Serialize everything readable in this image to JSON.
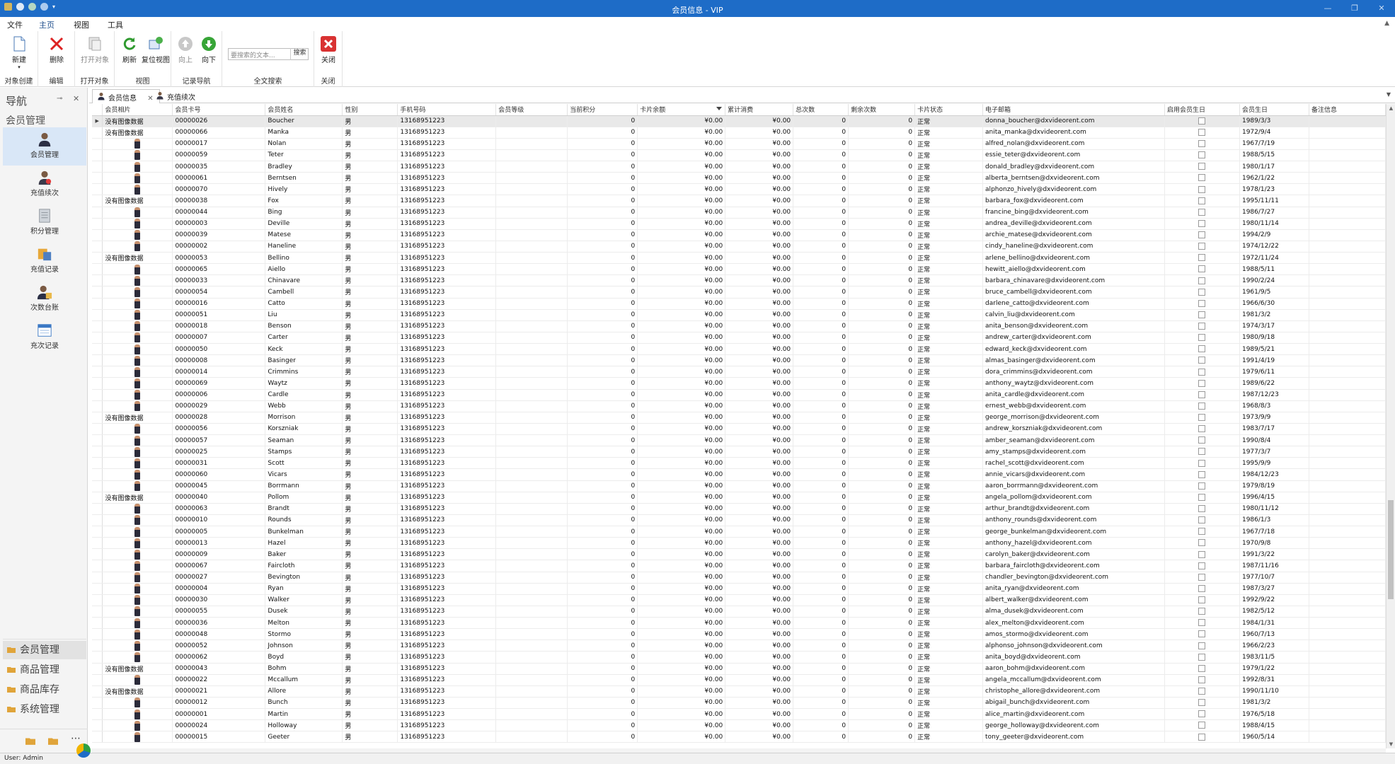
{
  "window": {
    "title": "会员信息 - VIP",
    "controls": [
      "—",
      "❐",
      "✕"
    ]
  },
  "menu": {
    "items": [
      "文件",
      "主页",
      "视图",
      "工具"
    ],
    "active_index": 1
  },
  "ribbon": {
    "groups": [
      {
        "label": "对象创建",
        "buttons": [
          {
            "label": "新建",
            "icon": "new-document-icon"
          }
        ]
      },
      {
        "label": "编辑",
        "buttons": [
          {
            "label": "删除",
            "icon": "delete-x-icon"
          }
        ]
      },
      {
        "label": "打开对象",
        "buttons": [
          {
            "label": "打开对象",
            "icon": "open-object-icon"
          }
        ]
      },
      {
        "label": "视图",
        "buttons": [
          {
            "label": "刷新",
            "icon": "refresh-icon"
          },
          {
            "label": "复位视图",
            "icon": "reset-view-icon"
          }
        ]
      },
      {
        "label": "记录导航",
        "buttons": [
          {
            "label": "向上",
            "icon": "arrow-up-icon"
          },
          {
            "label": "向下",
            "icon": "arrow-down-icon"
          }
        ]
      },
      {
        "label": "全文搜索",
        "search_placeholder": "要搜索的文本...",
        "search_button": "搜索"
      },
      {
        "label": "关闭",
        "buttons": [
          {
            "label": "关闭",
            "icon": "close-red-icon"
          }
        ]
      }
    ]
  },
  "nav": {
    "header": "导航",
    "pin": "⊸",
    "close": "✕",
    "group_title": "会员管理",
    "items": [
      {
        "label": "会员管理",
        "icon": "member-icon"
      },
      {
        "label": "充值续次",
        "icon": "recharge-icon"
      },
      {
        "label": "积分管理",
        "icon": "points-icon"
      },
      {
        "label": "充值记录",
        "icon": "recharge-record-icon"
      },
      {
        "label": "次数台账",
        "icon": "count-ledger-icon"
      },
      {
        "label": "充次记录",
        "icon": "count-record-icon"
      }
    ],
    "bottom_groups": [
      "会员管理",
      "商品管理",
      "商品库存",
      "系统管理"
    ],
    "footer_more": "⋯"
  },
  "doc_tabs": [
    {
      "label": "会员信息",
      "close": "✕"
    },
    {
      "label": "充值续次"
    }
  ],
  "grid": {
    "columns": [
      "会员相片",
      "会员卡号",
      "会员姓名",
      "性别",
      "手机号码",
      "会员等级",
      "当前积分",
      "卡片余额",
      "累计消费",
      "总次数",
      "剩余次数",
      "卡片状态",
      "电子邮箱",
      "启用会员生日",
      "会员生日",
      "备注信息"
    ],
    "no_photo_text": "没有图像数据",
    "selected_row_marker": "▶",
    "phone": "13168951223",
    "gender": "男",
    "points": "0",
    "balance": "¥0.00",
    "consumption": "¥0.00",
    "total_count": "0",
    "remaining_count": "0",
    "status": "正常",
    "rows": [
      {
        "photo": false,
        "card": "00000026",
        "name": "Boucher",
        "email": "donna_boucher@dxvideorent.com",
        "birthday": "1989/3/3"
      },
      {
        "photo": false,
        "card": "00000066",
        "name": "Manka",
        "email": "anita_manka@dxvideorent.com",
        "birthday": "1972/9/4"
      },
      {
        "photo": true,
        "card": "00000017",
        "name": "Nolan",
        "email": "alfred_nolan@dxvideorent.com",
        "birthday": "1967/7/19"
      },
      {
        "photo": true,
        "card": "00000059",
        "name": "Teter",
        "email": "essie_teter@dxvideorent.com",
        "birthday": "1988/5/15"
      },
      {
        "photo": true,
        "card": "00000035",
        "name": "Bradley",
        "email": "donald_bradley@dxvideorent.com",
        "birthday": "1980/1/17"
      },
      {
        "photo": true,
        "card": "00000061",
        "name": "Berntsen",
        "email": "alberta_berntsen@dxvideorent.com",
        "birthday": "1962/1/22"
      },
      {
        "photo": true,
        "card": "00000070",
        "name": "Hively",
        "email": "alphonzo_hively@dxvideorent.com",
        "birthday": "1978/1/23"
      },
      {
        "photo": false,
        "card": "00000038",
        "name": "Fox",
        "email": "barbara_fox@dxvideorent.com",
        "birthday": "1995/11/11"
      },
      {
        "photo": true,
        "card": "00000044",
        "name": "Bing",
        "email": "francine_bing@dxvideorent.com",
        "birthday": "1986/7/27"
      },
      {
        "photo": true,
        "card": "00000003",
        "name": "Deville",
        "email": "andrea_deville@dxvideorent.com",
        "birthday": "1980/11/14"
      },
      {
        "photo": true,
        "card": "00000039",
        "name": "Matese",
        "email": "archie_matese@dxvideorent.com",
        "birthday": "1994/2/9"
      },
      {
        "photo": true,
        "card": "00000002",
        "name": "Haneline",
        "email": "cindy_haneline@dxvideorent.com",
        "birthday": "1974/12/22"
      },
      {
        "photo": false,
        "card": "00000053",
        "name": "Bellino",
        "email": "arlene_bellino@dxvideorent.com",
        "birthday": "1972/11/24"
      },
      {
        "photo": true,
        "card": "00000065",
        "name": "Aiello",
        "email": "hewitt_aiello@dxvideorent.com",
        "birthday": "1988/5/11"
      },
      {
        "photo": true,
        "card": "00000033",
        "name": "Chinavare",
        "email": "barbara_chinavare@dxvideorent.com",
        "birthday": "1990/2/24"
      },
      {
        "photo": true,
        "card": "00000054",
        "name": "Cambell",
        "email": "bruce_cambell@dxvideorent.com",
        "birthday": "1961/9/5"
      },
      {
        "photo": true,
        "card": "00000016",
        "name": "Catto",
        "email": "darlene_catto@dxvideorent.com",
        "birthday": "1966/6/30"
      },
      {
        "photo": true,
        "card": "00000051",
        "name": "Liu",
        "email": "calvin_liu@dxvideorent.com",
        "birthday": "1981/3/2"
      },
      {
        "photo": true,
        "card": "00000018",
        "name": "Benson",
        "email": "anita_benson@dxvideorent.com",
        "birthday": "1974/3/17"
      },
      {
        "photo": true,
        "card": "00000007",
        "name": "Carter",
        "email": "andrew_carter@dxvideorent.com",
        "birthday": "1980/9/18"
      },
      {
        "photo": true,
        "card": "00000050",
        "name": "Keck",
        "email": "edward_keck@dxvideorent.com",
        "birthday": "1989/5/21"
      },
      {
        "photo": true,
        "card": "00000008",
        "name": "Basinger",
        "email": "almas_basinger@dxvideorent.com",
        "birthday": "1991/4/19"
      },
      {
        "photo": true,
        "card": "00000014",
        "name": "Crimmins",
        "email": "dora_crimmins@dxvideorent.com",
        "birthday": "1979/6/11"
      },
      {
        "photo": true,
        "card": "00000069",
        "name": "Waytz",
        "email": "anthony_waytz@dxvideorent.com",
        "birthday": "1989/6/22"
      },
      {
        "photo": true,
        "card": "00000006",
        "name": "Cardle",
        "email": "anita_cardle@dxvideorent.com",
        "birthday": "1987/12/23"
      },
      {
        "photo": true,
        "card": "00000029",
        "name": "Webb",
        "email": "ernest_webb@dxvideorent.com",
        "birthday": "1968/8/3"
      },
      {
        "photo": false,
        "card": "00000028",
        "name": "Morrison",
        "email": "george_morrison@dxvideorent.com",
        "birthday": "1973/9/9"
      },
      {
        "photo": true,
        "card": "00000056",
        "name": "Korszniak",
        "email": "andrew_korszniak@dxvideorent.com",
        "birthday": "1983/7/17"
      },
      {
        "photo": true,
        "card": "00000057",
        "name": "Seaman",
        "email": "amber_seaman@dxvideorent.com",
        "birthday": "1990/8/4"
      },
      {
        "photo": true,
        "card": "00000025",
        "name": "Stamps",
        "email": "amy_stamps@dxvideorent.com",
        "birthday": "1977/3/7"
      },
      {
        "photo": true,
        "card": "00000031",
        "name": "Scott",
        "email": "rachel_scott@dxvideorent.com",
        "birthday": "1995/9/9"
      },
      {
        "photo": true,
        "card": "00000060",
        "name": "Vicars",
        "email": "annie_vicars@dxvideorent.com",
        "birthday": "1984/12/23"
      },
      {
        "photo": true,
        "card": "00000045",
        "name": "Borrmann",
        "email": "aaron_borrmann@dxvideorent.com",
        "birthday": "1979/8/19"
      },
      {
        "photo": false,
        "card": "00000040",
        "name": "Pollom",
        "email": "angela_pollom@dxvideorent.com",
        "birthday": "1996/4/15"
      },
      {
        "photo": true,
        "card": "00000063",
        "name": "Brandt",
        "email": "arthur_brandt@dxvideorent.com",
        "birthday": "1980/11/12"
      },
      {
        "photo": true,
        "card": "00000010",
        "name": "Rounds",
        "email": "anthony_rounds@dxvideorent.com",
        "birthday": "1986/1/3"
      },
      {
        "photo": true,
        "card": "00000005",
        "name": "Bunkelman",
        "email": "george_bunkelman@dxvideorent.com",
        "birthday": "1967/7/18"
      },
      {
        "photo": true,
        "card": "00000013",
        "name": "Hazel",
        "email": "anthony_hazel@dxvideorent.com",
        "birthday": "1970/9/8"
      },
      {
        "photo": true,
        "card": "00000009",
        "name": "Baker",
        "email": "carolyn_baker@dxvideorent.com",
        "birthday": "1991/3/22"
      },
      {
        "photo": true,
        "card": "00000067",
        "name": "Faircloth",
        "email": "barbara_faircloth@dxvideorent.com",
        "birthday": "1987/11/16"
      },
      {
        "photo": true,
        "card": "00000027",
        "name": "Bevington",
        "email": "chandler_bevington@dxvideorent.com",
        "birthday": "1977/10/7"
      },
      {
        "photo": true,
        "card": "00000004",
        "name": "Ryan",
        "email": "anita_ryan@dxvideorent.com",
        "birthday": "1987/3/27"
      },
      {
        "photo": true,
        "card": "00000030",
        "name": "Walker",
        "email": "albert_walker@dxvideorent.com",
        "birthday": "1992/9/22"
      },
      {
        "photo": true,
        "card": "00000055",
        "name": "Dusek",
        "email": "alma_dusek@dxvideorent.com",
        "birthday": "1982/5/12"
      },
      {
        "photo": true,
        "card": "00000036",
        "name": "Melton",
        "email": "alex_melton@dxvideorent.com",
        "birthday": "1984/1/31"
      },
      {
        "photo": true,
        "card": "00000048",
        "name": "Stormo",
        "email": "amos_stormo@dxvideorent.com",
        "birthday": "1960/7/13"
      },
      {
        "photo": true,
        "card": "00000052",
        "name": "Johnson",
        "email": "alphonso_johnson@dxvideorent.com",
        "birthday": "1966/2/23"
      },
      {
        "photo": true,
        "card": "00000062",
        "name": "Boyd",
        "email": "anita_boyd@dxvideorent.com",
        "birthday": "1983/11/5"
      },
      {
        "photo": false,
        "card": "00000043",
        "name": "Bohm",
        "email": "aaron_bohm@dxvideorent.com",
        "birthday": "1979/1/22"
      },
      {
        "photo": true,
        "card": "00000022",
        "name": "Mccallum",
        "email": "angela_mccallum@dxvideorent.com",
        "birthday": "1992/8/31"
      },
      {
        "photo": false,
        "card": "00000021",
        "name": "Allore",
        "email": "christophe_allore@dxvideorent.com",
        "birthday": "1990/11/10"
      },
      {
        "photo": true,
        "card": "00000012",
        "name": "Bunch",
        "email": "abigail_bunch@dxvideorent.com",
        "birthday": "1981/3/2"
      },
      {
        "photo": true,
        "card": "00000001",
        "name": "Martin",
        "email": "alice_martin@dxvideorent.com",
        "birthday": "1976/5/18"
      },
      {
        "photo": true,
        "card": "00000024",
        "name": "Holloway",
        "email": "george_holloway@dxvideorent.com",
        "birthday": "1988/4/15"
      },
      {
        "photo": true,
        "card": "00000015",
        "name": "Geeter",
        "email": "tony_geeter@dxvideorent.com",
        "birthday": "1960/5/14"
      }
    ]
  },
  "status": {
    "user_text": "User: Admin"
  }
}
